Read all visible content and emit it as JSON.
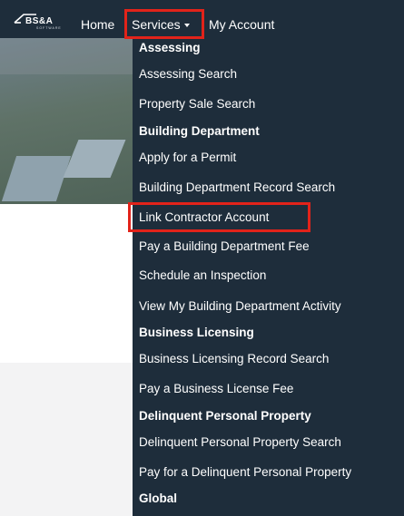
{
  "navbar": {
    "logo_text": "BS&A",
    "logo_subtext": "SOFTWARE",
    "home_label": "Home",
    "services_label": "Services",
    "account_label": "My Account"
  },
  "menu": [
    {
      "label": "Assessing",
      "kind": "header"
    },
    {
      "label": "Assessing Search",
      "kind": "item"
    },
    {
      "label": "Property Sale Search",
      "kind": "item"
    },
    {
      "label": "Building Department",
      "kind": "header"
    },
    {
      "label": "Apply for a Permit",
      "kind": "item"
    },
    {
      "label": "Building Department Record Search",
      "kind": "item"
    },
    {
      "label": "Link Contractor Account",
      "kind": "item",
      "highlighted": true
    },
    {
      "label": "Pay a Building Department Fee",
      "kind": "item"
    },
    {
      "label": "Schedule an Inspection",
      "kind": "item"
    },
    {
      "label": "View My Building Department Activity",
      "kind": "item"
    },
    {
      "label": "Business Licensing",
      "kind": "header"
    },
    {
      "label": "Business Licensing Record Search",
      "kind": "item"
    },
    {
      "label": "Pay a Business License Fee",
      "kind": "item"
    },
    {
      "label": "Delinquent Personal Property",
      "kind": "header"
    },
    {
      "label": "Delinquent Personal Property Search",
      "kind": "item"
    },
    {
      "label": "Pay for a Delinquent Personal Property",
      "kind": "item"
    },
    {
      "label": "Global",
      "kind": "header"
    }
  ],
  "colors": {
    "nav_background": "#1e2d3b",
    "highlight": "#e2231a",
    "text": "#ffffff"
  }
}
